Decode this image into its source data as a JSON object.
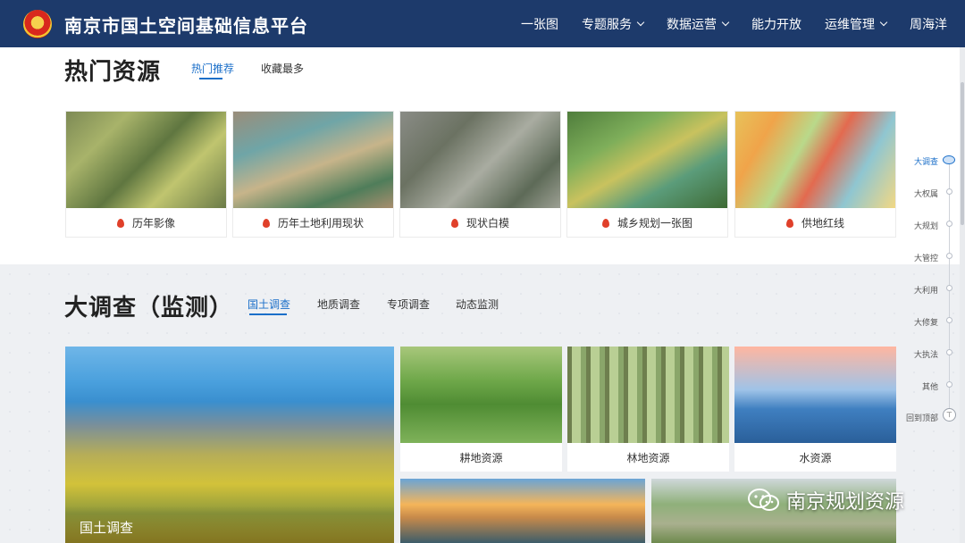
{
  "header": {
    "title": "南京市国土空间基础信息平台",
    "nav": [
      {
        "label": "一张图",
        "has_dropdown": false
      },
      {
        "label": "专题服务",
        "has_dropdown": true
      },
      {
        "label": "数据运营",
        "has_dropdown": true
      },
      {
        "label": "能力开放",
        "has_dropdown": false
      },
      {
        "label": "运维管理",
        "has_dropdown": true
      }
    ],
    "user": "周海洋"
  },
  "hot": {
    "title": "热门资源",
    "tabs": [
      "热门推荐",
      "收藏最多"
    ],
    "cards": [
      "历年影像",
      "历年土地利用现状",
      "现状白模",
      "城乡规划一张图",
      "供地红线"
    ]
  },
  "survey": {
    "title": "大调查（监测）",
    "tabs": [
      "国土调查",
      "地质调查",
      "专项调查",
      "动态监测"
    ],
    "featured_label": "国土调查",
    "cards": [
      "耕地资源",
      "林地资源",
      "水资源"
    ]
  },
  "rail": {
    "items": [
      "大调查",
      "大权属",
      "大规划",
      "大管控",
      "大利用",
      "大修复",
      "大执法",
      "其他",
      "回到顶部"
    ]
  },
  "watermark": "南京规划资源",
  "colors": {
    "header_bg": "#1d3a6b",
    "accent": "#1b6fc9",
    "flame": "#e0402a"
  }
}
